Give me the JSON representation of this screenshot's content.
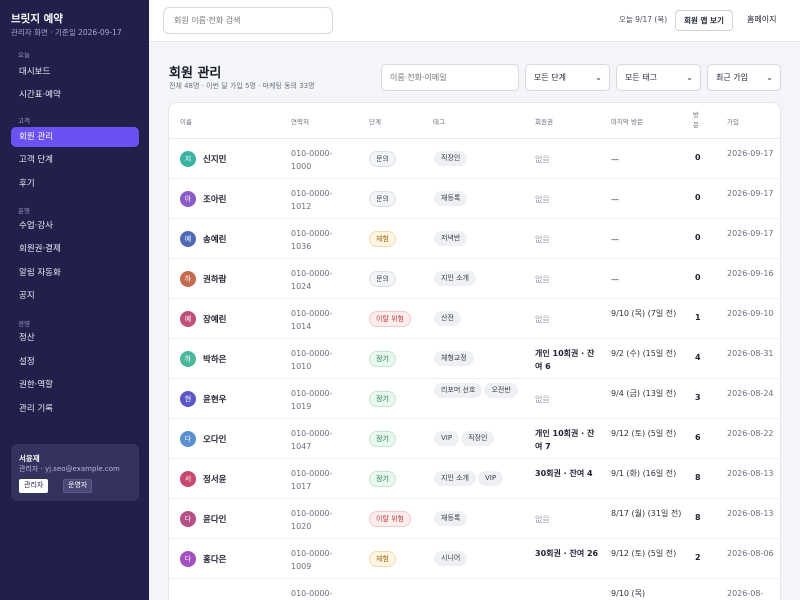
{
  "sidebar": {
    "brand": "브릿지 예약",
    "subtitle": "관리자 화면 · 기준일 2026-09-17",
    "sections": {
      "today": "오늘",
      "customers": "고객",
      "operations": "운영",
      "management": "경영"
    },
    "items": [
      {
        "label": "대시보드"
      },
      {
        "label": "시간표·예약"
      },
      {
        "label": "회원 관리"
      },
      {
        "label": "고객 단계"
      },
      {
        "label": "후기"
      },
      {
        "label": "수업·강사"
      },
      {
        "label": "회원권·결제"
      },
      {
        "label": "알림 자동화"
      },
      {
        "label": "공지"
      },
      {
        "label": "정산"
      },
      {
        "label": "설정"
      },
      {
        "label": "권한·역할"
      },
      {
        "label": "관리 기록"
      }
    ],
    "user": {
      "name": "서윤재",
      "email": "관리자 · yj.seo@example.com",
      "role_admin": "관리자",
      "role_operator": "운영자"
    }
  },
  "topbar": {
    "search_placeholder": "회원 이름·전화 검색",
    "date": "오늘 9/17 (목)",
    "member_app_button": "회원 앱 보기",
    "home_link": "홈페이지"
  },
  "main": {
    "title": "회원 관리",
    "subtitle": "전체 48명 · 이번 달 가입 5명 · 마케팅 동의 33명",
    "filter_placeholder": "이름·전화·이메일",
    "stage_select": "모든 단계",
    "tag_select": "모든 태그",
    "sort_select": "최근 가입"
  },
  "table": {
    "headers": {
      "name": "이름",
      "phone": "연락처",
      "stage": "단계",
      "tags": "태그",
      "pass": "회원권",
      "last_visit": "마지막 방문",
      "visits": "방문",
      "joined": "가입"
    },
    "rows": [
      {
        "initial": "지",
        "name": "신지민",
        "phone": "010-0000-1000",
        "stage": "문의",
        "tags": [
          "직장인"
        ],
        "pass": "없음",
        "last_visit": "—",
        "visits": "0",
        "joined": "2026-09-17"
      },
      {
        "initial": "아",
        "name": "조아린",
        "phone": "010-0000-1012",
        "stage": "문의",
        "tags": [
          "재등록"
        ],
        "pass": "없음",
        "last_visit": "—",
        "visits": "0",
        "joined": "2026-09-17"
      },
      {
        "initial": "예",
        "name": "송예린",
        "phone": "010-0000-1036",
        "stage": "체험",
        "tags": [
          "저녁반"
        ],
        "pass": "없음",
        "last_visit": "—",
        "visits": "0",
        "joined": "2026-09-17"
      },
      {
        "initial": "하",
        "name": "권하람",
        "phone": "010-0000-1024",
        "stage": "문의",
        "tags": [
          "지인 소개"
        ],
        "pass": "없음",
        "last_visit": "—",
        "visits": "0",
        "joined": "2026-09-16"
      },
      {
        "initial": "예",
        "name": "장예린",
        "phone": "010-0000-1014",
        "stage": "이탈 위험",
        "tags": [
          "산전"
        ],
        "pass": "없음",
        "last_visit": "9/10 (목) (7일 전)",
        "visits": "1",
        "joined": "2026-09-10"
      },
      {
        "initial": "하",
        "name": "박하은",
        "phone": "010-0000-1010",
        "stage": "정기",
        "tags": [
          "체형교정"
        ],
        "pass": "개인 10회권 · 잔여 6",
        "last_visit": "9/2 (수) (15일 전)",
        "visits": "4",
        "joined": "2026-08-31"
      },
      {
        "initial": "현",
        "name": "윤현우",
        "phone": "010-0000-1019",
        "stage": "정기",
        "tags": [
          "리포머 선호",
          "오전반"
        ],
        "pass": "없음",
        "last_visit": "9/4 (금) (13일 전)",
        "visits": "3",
        "joined": "2026-08-24"
      },
      {
        "initial": "다",
        "name": "오다인",
        "phone": "010-0000-1047",
        "stage": "정기",
        "tags": [
          "VIP",
          "직장인"
        ],
        "pass": "개인 10회권 · 잔여 7",
        "last_visit": "9/12 (토) (5일 전)",
        "visits": "6",
        "joined": "2026-08-22"
      },
      {
        "initial": "서",
        "name": "정서윤",
        "phone": "010-0000-1017",
        "stage": "정기",
        "tags": [
          "지인 소개",
          "VIP"
        ],
        "pass": "30회권 · 잔여 4",
        "last_visit": "9/1 (화) (16일 전)",
        "visits": "8",
        "joined": "2026-08-13"
      },
      {
        "initial": "다",
        "name": "윤다인",
        "phone": "010-0000-1020",
        "stage": "이탈 위험",
        "tags": [
          "재등록"
        ],
        "pass": "없음",
        "last_visit": "8/17 (월) (31일 전)",
        "visits": "8",
        "joined": "2026-08-13"
      },
      {
        "initial": "다",
        "name": "홍다은",
        "phone": "010-0000-1009",
        "stage": "체험",
        "tags": [
          "시니어"
        ],
        "pass": "30회권 · 잔여 26",
        "last_visit": "9/12 (토) (5일 전)",
        "visits": "2",
        "joined": "2026-08-06"
      },
      {
        "initial": "",
        "name": "",
        "phone": "010-0000-",
        "stage": "",
        "tags": [],
        "pass": "",
        "last_visit": "9/10 (목)",
        "visits": "",
        "joined": "2026-08-"
      }
    ]
  },
  "colors": {
    "sidebar_bg": "#22204a",
    "accent": "#6a52f2",
    "avatars": [
      "#39b3a0",
      "#8a5cc9",
      "#4f6bb8",
      "#c46a4d",
      "#c0507a",
      "#4bb89c",
      "#5b57c9",
      "#5a8fd0",
      "#c9466e",
      "#b64f86",
      "#a24fbf",
      "#3cab8e"
    ]
  }
}
